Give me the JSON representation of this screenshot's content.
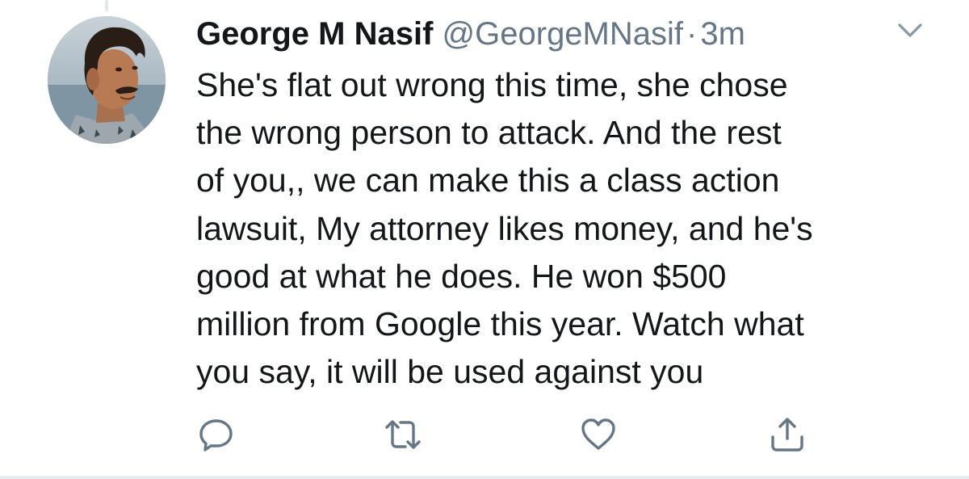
{
  "tweet": {
    "display_name": "George M Nasif",
    "handle": "@GeorgeMNasif",
    "separator": "·",
    "time": "3m",
    "text": "She's flat out wrong this time, she chose\nthe wrong person to attack. And the rest\nof you,, we can make this a class action\nlawsuit, My attorney likes money, and he's\ngood at what he does. He won $500\nmillion from Google this year. Watch what\nyou say, it will be used against you"
  },
  "icons": {
    "caret": "chevron-down-icon",
    "reply": "reply-icon",
    "retweet": "retweet-icon",
    "like": "heart-icon",
    "share": "share-icon"
  },
  "colors": {
    "text_primary": "#14171a",
    "text_secondary": "#657786",
    "icon": "#657786",
    "border": "#e6ecf0"
  }
}
